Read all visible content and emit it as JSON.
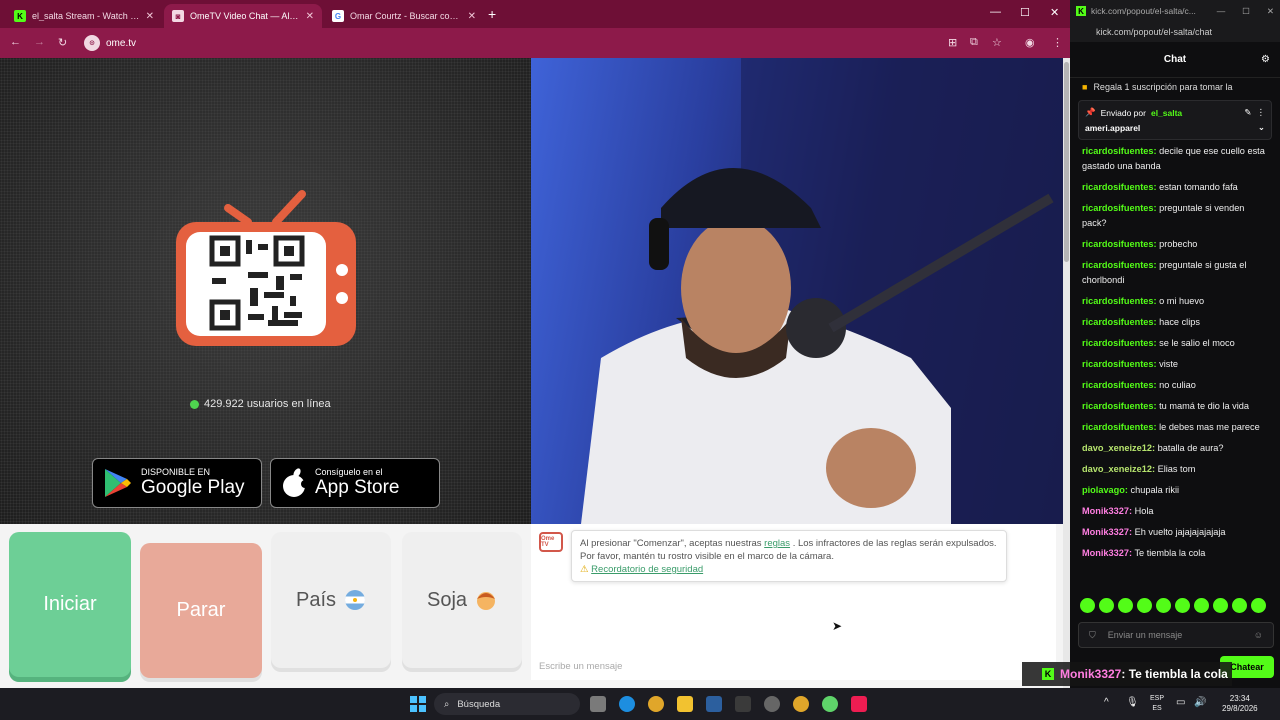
{
  "tabs": [
    {
      "title": "el_salta Stream - Watch Live on",
      "fav": "K",
      "favbg": "#53fc18"
    },
    {
      "title": "OmeTV Video Chat — Alter",
      "fav": "◙",
      "favbg": "#f3d9e4"
    },
    {
      "title": "Omar Courtz - Buscar con Goo",
      "fav": "G",
      "favbg": "#ffffff"
    }
  ],
  "browser": {
    "url": "ome.tv",
    "new_tab": "+"
  },
  "ome": {
    "online_count": "429.922 usuarios en línea",
    "google_play_small": "DISPONIBLE EN",
    "google_play_big": "Google Play",
    "app_store_small": "Consíguelo en el",
    "app_store_big": "App Store",
    "start_label": "Iniciar",
    "stop_label": "Parar",
    "country_label": "País",
    "gender_label": "Soja",
    "logo_text": "Ome TV",
    "notice_pre": "Al presionar \"Comenzar\", aceptas nuestras",
    "notice_link": "reglas",
    "notice_post": ". Los infractores de las reglas serán expulsados. Por favor, mantén tu rostro visible en el marco de la cámara.",
    "safety_link": "Recordatorio de seguridad",
    "message_placeholder": "Escribe un mensaje"
  },
  "kick": {
    "window_url_short": "kick.com/popout/el-salta/c...",
    "url": "kick.com/popout/el-salta/chat",
    "header": "Chat",
    "sub_gift": "Regala 1 suscripción para tomar la",
    "pinned_sent_by": "Enviado por",
    "pinned_user": "el_salta",
    "pinned_text": "ameri.apparel",
    "input_placeholder": "Enviar un mensaje",
    "send_label": "Chatear",
    "messages": [
      {
        "user": "ricardosifuentes:",
        "text": "decile que ese cuello esta gastado una banda",
        "color": "g"
      },
      {
        "user": "ricardosifuentes:",
        "text": "estan tomando fafa",
        "color": "g"
      },
      {
        "user": "ricardosifuentes:",
        "text": "preguntale si venden pack?",
        "color": "g"
      },
      {
        "user": "ricardosifuentes:",
        "text": "probecho",
        "color": "g"
      },
      {
        "user": "ricardosifuentes:",
        "text": "preguntale si gusta el chorlbondi",
        "color": "g"
      },
      {
        "user": "ricardosifuentes:",
        "text": "o mi huevo",
        "color": "g"
      },
      {
        "user": "ricardosifuentes:",
        "text": "hace clips",
        "color": "g"
      },
      {
        "user": "ricardosifuentes:",
        "text": "se le salio el moco",
        "color": "g"
      },
      {
        "user": "ricardosifuentes:",
        "text": "viste",
        "color": "g"
      },
      {
        "user": "ricardosifuentes:",
        "text": "no culiao",
        "color": "g"
      },
      {
        "user": "ricardosifuentes:",
        "text": "tu mamá te dio la vida",
        "color": "g"
      },
      {
        "user": "ricardosifuentes:",
        "text": "le debes mas me parece",
        "color": "g"
      },
      {
        "user": "davo_xeneize12:",
        "text": "batalla de aura?",
        "color": "gy"
      },
      {
        "user": "davo_xeneize12:",
        "text": "Elias tom",
        "color": "gy"
      },
      {
        "user": "piolavago:",
        "text": "chupala rikii",
        "color": "g"
      },
      {
        "user": "Monik3327:",
        "text": "Hola",
        "color": "pk"
      },
      {
        "user": "Monik3327:",
        "text": "Eh vuelto jajajajajajaja",
        "color": "pk"
      },
      {
        "user": "Monik3327:",
        "text": "Te tiembla la cola",
        "color": "pk"
      }
    ]
  },
  "overlay": {
    "user": "Monik3327",
    "text": ": Te tiembla la cola"
  },
  "taskbar": {
    "search": "Búsqueda",
    "lang1": "ESP",
    "lang2": "ES",
    "time": "23:34",
    "date": "29/8/2026"
  }
}
